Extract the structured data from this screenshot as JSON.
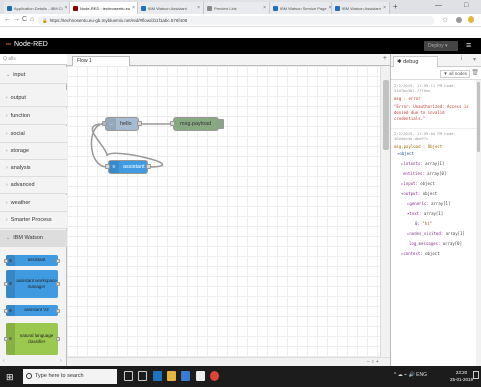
{
  "browser": {
    "tabs": [
      {
        "title": "Application Details - IBM Cl",
        "color": "#1d6fa5",
        "active": false
      },
      {
        "title": "Node-RED : technosentu.eu",
        "color": "#8f0000",
        "active": true
      },
      {
        "title": "IBM Watson Assistant",
        "color": "#1f70c1",
        "active": false
      },
      {
        "title": "Preview Link",
        "color": "#888888",
        "active": false
      },
      {
        "title": "IBM Watson Service Page",
        "color": "#1f70c1",
        "active": false
      },
      {
        "title": "IBM Watson Assistant",
        "color": "#1f70c1",
        "active": false
      }
    ],
    "new_tab": "+",
    "controls": {
      "minimize": "—",
      "restore": "□"
    },
    "back": "←",
    "forward": "→",
    "reload": "C",
    "home": "⌂",
    "url_prefix": "https://",
    "url": "technosentu.eu-gb.mybluemix.net/red/#flow/d11f1abc.576f408",
    "star": "☆"
  },
  "nodered": {
    "logo": "Node-RED",
    "logo_mark": "∞",
    "deploy_label": "Deploy ▾",
    "menu": "≡"
  },
  "palette": {
    "filter_placeholder": "Q alls",
    "categories": [
      {
        "label": "input",
        "chev": "⌄"
      },
      {
        "label": "output",
        "chev": "›"
      },
      {
        "label": "function",
        "chev": "›"
      },
      {
        "label": "social",
        "chev": "›"
      },
      {
        "label": "storage",
        "chev": "›"
      },
      {
        "label": "analysis",
        "chev": "›"
      },
      {
        "label": "advanced",
        "chev": "›"
      },
      {
        "label": "weather",
        "chev": "›"
      },
      {
        "label": "Smarter Process",
        "chev": "›"
      },
      {
        "label": "IBM Watson",
        "chev": "⌄"
      }
    ],
    "nodes": [
      {
        "label": "assistant",
        "color": "#3f9ae0"
      },
      {
        "label": "assistant workspace manager",
        "color": "#3f9ae0"
      },
      {
        "label": "assistant V2",
        "color": "#3f9ae0"
      },
      {
        "label": "natural language classifier",
        "color": "#9bc94f"
      }
    ]
  },
  "workspace": {
    "tab_label": "Flow 1",
    "add_tab": "+",
    "nodes": {
      "hello": "hello",
      "assistant": "assistant",
      "debug": "msg.payload"
    },
    "zoom_controls": "− ○ +"
  },
  "sidebar": {
    "tab_label": "debug",
    "info_icon": "i",
    "filter_label": "all nodes",
    "entries": [
      {
        "meta": "2/2/2019, 11:59:11 PM node: 33d7ba3b2.77f0ee",
        "topic": "msg : error",
        "text": "\"Error: Unauthorized: Access is denied due to invalid credentials.\""
      },
      {
        "meta": "2/2/2019, 11:59:04 PM node: 30d4eb4e.dba97c",
        "topic": "msg.payload : Object"
      }
    ],
    "tree": [
      {
        "arrow": "▾",
        "key": "object",
        "type": ""
      },
      {
        "arrow": "▸",
        "key": "intents",
        "type": "array[1]"
      },
      {
        "arrow": "",
        "key": "entities",
        "type": "array[0]"
      },
      {
        "arrow": "▸",
        "key": "input",
        "type": "object"
      },
      {
        "arrow": "▾",
        "key": "output",
        "type": "object"
      },
      {
        "arrow": "▸",
        "key": "generic",
        "type": "array[1]"
      },
      {
        "arrow": "▾",
        "key": "text",
        "type": "array[1]"
      },
      {
        "arrow": "",
        "key": "0",
        "type": "\"hi\""
      },
      {
        "arrow": "▸",
        "key": "nodes_visited",
        "type": "array[1]"
      },
      {
        "arrow": "",
        "key": "log_messages",
        "type": "array[0]"
      },
      {
        "arrow": "▸",
        "key": "context",
        "type": "object"
      }
    ]
  },
  "taskbar": {
    "search_placeholder": "Type here to search",
    "time": "23:20",
    "date": "25-01-2019",
    "lang": "ENG",
    "tray": "^ ☁ ⌁ 🔊"
  }
}
